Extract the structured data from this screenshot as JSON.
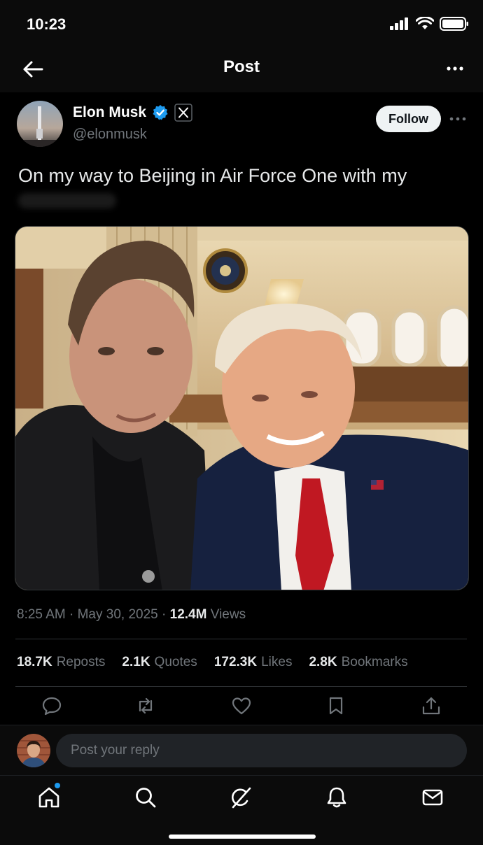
{
  "status_bar": {
    "time": "10:23"
  },
  "nav": {
    "title": "Post",
    "back_icon": "arrow-left-icon",
    "more_icon": "more-horizontal-icon"
  },
  "author": {
    "name": "Elon Musk",
    "handle": "@elonmusk",
    "verified_color": "#1d9bf0",
    "follow_label": "Follow"
  },
  "tweet": {
    "text": "On my way to Beijing in Air Force One with my",
    "time": "8:25 AM",
    "date": "May 30, 2025",
    "views_count": "12.4M",
    "views_label": "Views"
  },
  "stats": [
    {
      "count": "18.7K",
      "label": "Reposts"
    },
    {
      "count": "2.1K",
      "label": "Quotes"
    },
    {
      "count": "172.3K",
      "label": "Likes"
    },
    {
      "count": "2.8K",
      "label": "Bookmarks"
    }
  ],
  "actions": [
    "reply-icon",
    "repost-icon",
    "like-icon",
    "bookmark-icon",
    "share-icon"
  ],
  "reply": {
    "placeholder": "Post your reply"
  },
  "tabs": [
    "home-icon",
    "search-icon",
    "grok-icon",
    "notifications-icon",
    "messages-icon"
  ],
  "colors": {
    "background": "#000000",
    "accent": "#1d9bf0",
    "muted": "#71767b"
  }
}
